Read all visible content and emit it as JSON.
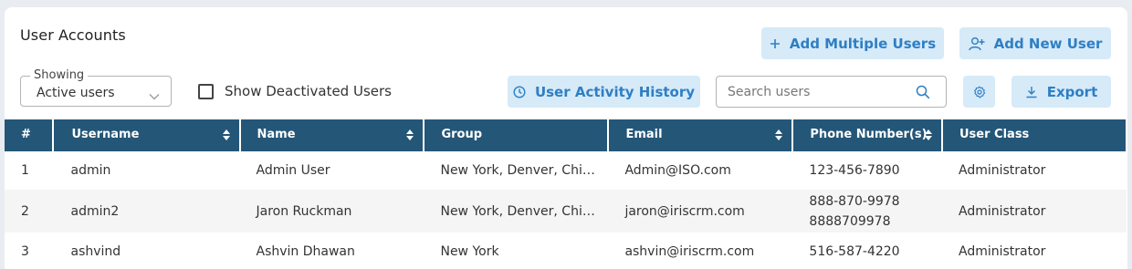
{
  "header": {
    "title": "User Accounts",
    "add_multiple_label": "Add Multiple Users",
    "add_new_label": "Add New User"
  },
  "toolbar": {
    "showing_legend": "Showing",
    "showing_value": "Active users",
    "show_deactivated_label": "Show Deactivated Users",
    "show_deactivated_checked": false,
    "activity_history_label": "User Activity History",
    "search_placeholder": "Search users",
    "export_label": "Export"
  },
  "icons": {
    "add_multiple": "plus-icon",
    "add_new": "add-user-icon",
    "activity": "clock-icon",
    "search": "search-icon",
    "settings": "gear-icon",
    "export": "download-icon",
    "dropdown": "chevron-down-icon",
    "sort": "sort-icon"
  },
  "colors": {
    "accent": "#2e7fc4",
    "button_bg": "#d6eaf8",
    "table_header_bg": "#245678",
    "alt_row_bg": "#f5f5f5"
  },
  "table": {
    "columns": [
      {
        "label": "#",
        "sortable": false
      },
      {
        "label": "Username",
        "sortable": true
      },
      {
        "label": "Name",
        "sortable": true
      },
      {
        "label": "Group",
        "sortable": false
      },
      {
        "label": "Email",
        "sortable": true
      },
      {
        "label": "Phone Number(s)",
        "sortable": true
      },
      {
        "label": "User Class",
        "sortable": false
      }
    ],
    "rows": [
      {
        "num": "1",
        "username": "admin",
        "name": "Admin User",
        "group": "New York, Denver, Chi…",
        "email": "Admin@ISO.com",
        "phones": [
          "123-456-7890"
        ],
        "user_class": "Administrator"
      },
      {
        "num": "2",
        "username": "admin2",
        "name": "Jaron Ruckman",
        "group": "New York, Denver, Chi…",
        "email": "jaron@iriscrm.com",
        "phones": [
          "888-870-9978",
          "8888709978"
        ],
        "user_class": "Administrator"
      },
      {
        "num": "3",
        "username": "ashvind",
        "name": "Ashvin Dhawan",
        "group": "New York",
        "email": "ashvin@iriscrm.com",
        "phones": [
          "516-587-4220"
        ],
        "user_class": "Administrator"
      }
    ]
  }
}
